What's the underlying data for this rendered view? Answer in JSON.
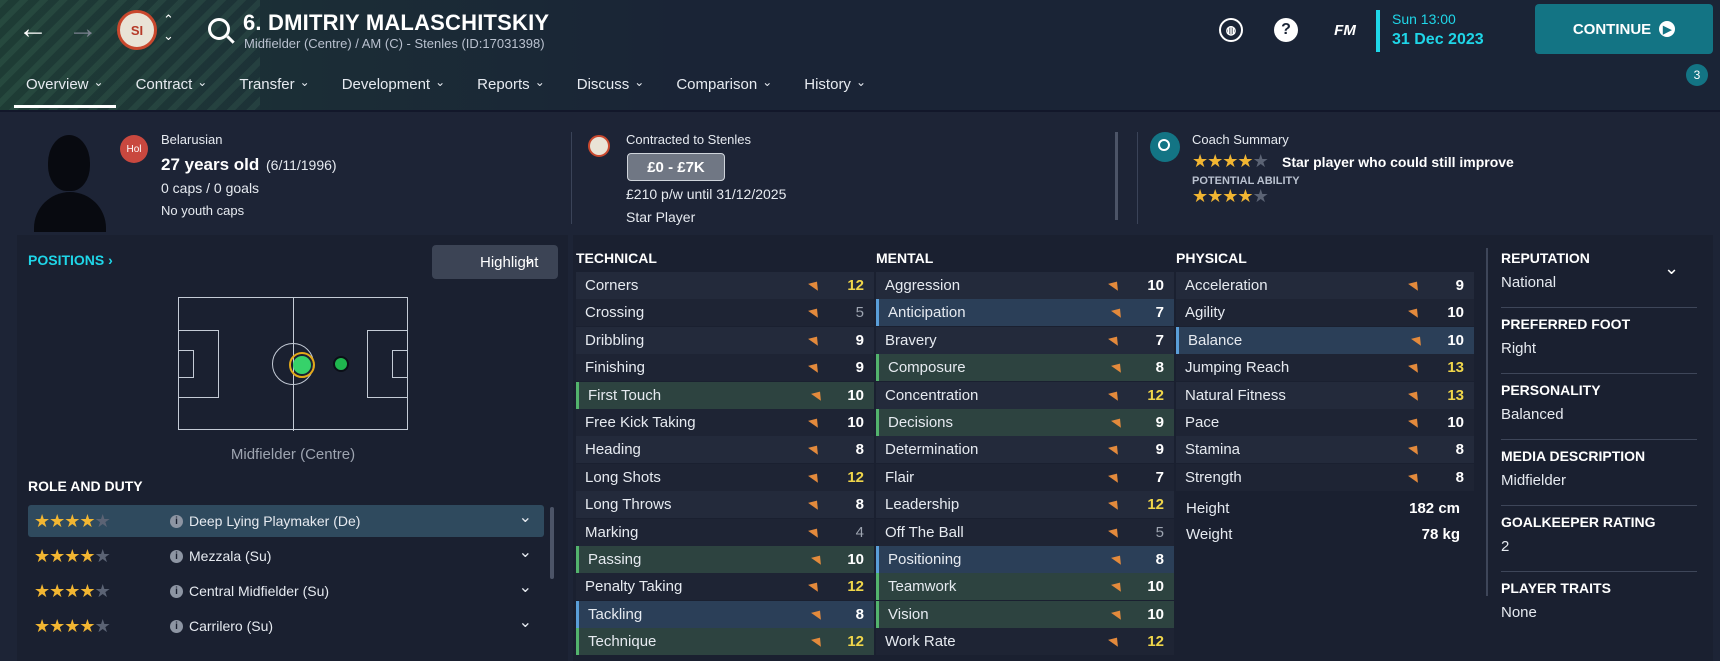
{
  "header": {
    "player_name": "6. DMITRIY MALASCHITSKIY",
    "subtitle": "Midfielder (Centre) / AM (C) - Stenles (ID:17031398)",
    "crest_text": "SI",
    "fm_label": "FM",
    "time": "Sun 13:00",
    "date": "31 Dec 2023",
    "continue_label": "CONTINUE",
    "notification_count": "3"
  },
  "tabs": [
    "Overview",
    "Contract",
    "Transfer",
    "Development",
    "Reports",
    "Discuss",
    "Comparison",
    "History"
  ],
  "info": {
    "nationality": "Belarusian",
    "flag_code": "Hol",
    "age": "27 years old",
    "dob": "(6/11/1996)",
    "caps": "0 caps / 0 goals",
    "youth": "No youth caps",
    "contracted": "Contracted to Stenles",
    "value": "£0 - £7K",
    "wage": "£210 p/w until 31/12/2025",
    "status": "Star Player",
    "coach_title": "Coach Summary",
    "coach_summary": "Star player who could still improve",
    "potential_label": "POTENTIAL ABILITY",
    "current_stars": 4,
    "potential_stars": 4
  },
  "positions": {
    "title": "POSITIONS",
    "highlight_label": "Highlight",
    "position_label": "Midfielder (Centre)",
    "role_title": "ROLE AND DUTY",
    "roles": [
      {
        "name": "Deep Lying Playmaker (De)",
        "stars": 4
      },
      {
        "name": "Mezzala (Su)",
        "stars": 4
      },
      {
        "name": "Central Midfielder (Su)",
        "stars": 4
      },
      {
        "name": "Carrilero (Su)",
        "stars": 4
      }
    ]
  },
  "technical": {
    "title": "TECHNICAL",
    "rows": [
      {
        "name": "Corners",
        "value": "12",
        "style": "odd",
        "color": "y"
      },
      {
        "name": "Crossing",
        "value": "5",
        "style": "even",
        "color": "g"
      },
      {
        "name": "Dribbling",
        "value": "9",
        "style": "odd",
        "color": "w"
      },
      {
        "name": "Finishing",
        "value": "9",
        "style": "even",
        "color": "w"
      },
      {
        "name": "First Touch",
        "value": "10",
        "style": "green",
        "color": "w"
      },
      {
        "name": "Free Kick Taking",
        "value": "10",
        "style": "even",
        "color": "w"
      },
      {
        "name": "Heading",
        "value": "8",
        "style": "odd",
        "color": "w"
      },
      {
        "name": "Long Shots",
        "value": "12",
        "style": "even",
        "color": "y"
      },
      {
        "name": "Long Throws",
        "value": "8",
        "style": "odd",
        "color": "w"
      },
      {
        "name": "Marking",
        "value": "4",
        "style": "even",
        "color": "g"
      },
      {
        "name": "Passing",
        "value": "10",
        "style": "green",
        "color": "w"
      },
      {
        "name": "Penalty Taking",
        "value": "12",
        "style": "even",
        "color": "y"
      },
      {
        "name": "Tackling",
        "value": "8",
        "style": "blue",
        "color": "w"
      },
      {
        "name": "Technique",
        "value": "12",
        "style": "green",
        "color": "y"
      }
    ]
  },
  "mental": {
    "title": "MENTAL",
    "rows": [
      {
        "name": "Aggression",
        "value": "10",
        "style": "odd",
        "color": "w"
      },
      {
        "name": "Anticipation",
        "value": "7",
        "style": "blue",
        "color": "w"
      },
      {
        "name": "Bravery",
        "value": "7",
        "style": "odd",
        "color": "w"
      },
      {
        "name": "Composure",
        "value": "8",
        "style": "green",
        "color": "w"
      },
      {
        "name": "Concentration",
        "value": "12",
        "style": "odd",
        "color": "y"
      },
      {
        "name": "Decisions",
        "value": "9",
        "style": "green",
        "color": "w"
      },
      {
        "name": "Determination",
        "value": "9",
        "style": "odd",
        "color": "w"
      },
      {
        "name": "Flair",
        "value": "7",
        "style": "even",
        "color": "w"
      },
      {
        "name": "Leadership",
        "value": "12",
        "style": "odd",
        "color": "y"
      },
      {
        "name": "Off The Ball",
        "value": "5",
        "style": "even",
        "color": "g"
      },
      {
        "name": "Positioning",
        "value": "8",
        "style": "blue",
        "color": "w"
      },
      {
        "name": "Teamwork",
        "value": "10",
        "style": "green",
        "color": "w"
      },
      {
        "name": "Vision",
        "value": "10",
        "style": "green",
        "color": "w"
      },
      {
        "name": "Work Rate",
        "value": "12",
        "style": "even",
        "color": "y"
      }
    ]
  },
  "physical": {
    "title": "PHYSICAL",
    "rows": [
      {
        "name": "Acceleration",
        "value": "9",
        "style": "odd",
        "color": "w"
      },
      {
        "name": "Agility",
        "value": "10",
        "style": "even",
        "color": "w"
      },
      {
        "name": "Balance",
        "value": "10",
        "style": "blue",
        "color": "w"
      },
      {
        "name": "Jumping Reach",
        "value": "13",
        "style": "even",
        "color": "y"
      },
      {
        "name": "Natural Fitness",
        "value": "13",
        "style": "odd",
        "color": "y"
      },
      {
        "name": "Pace",
        "value": "10",
        "style": "even",
        "color": "w"
      },
      {
        "name": "Stamina",
        "value": "8",
        "style": "odd",
        "color": "w"
      },
      {
        "name": "Strength",
        "value": "8",
        "style": "even",
        "color": "w"
      }
    ],
    "height_label": "Height",
    "height": "182 cm",
    "weight_label": "Weight",
    "weight": "78 kg"
  },
  "details": [
    {
      "label": "REPUTATION",
      "value": "National"
    },
    {
      "label": "PREFERRED FOOT",
      "value": "Right"
    },
    {
      "label": "PERSONALITY",
      "value": "Balanced"
    },
    {
      "label": "MEDIA DESCRIPTION",
      "value": "Midfielder"
    },
    {
      "label": "GOALKEEPER RATING",
      "value": "2"
    },
    {
      "label": "PLAYER TRAITS",
      "value": "None"
    }
  ]
}
